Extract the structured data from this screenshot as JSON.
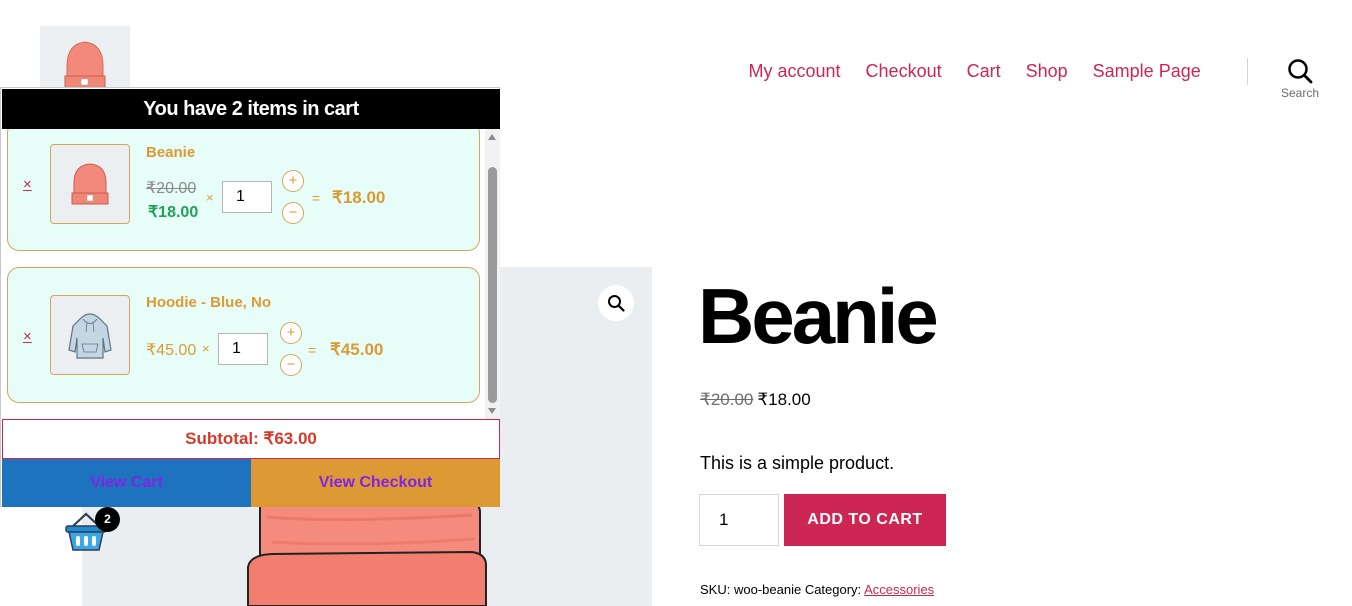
{
  "header": {
    "logo_icon": "beanie-logo",
    "nav": [
      "My account",
      "Checkout",
      "Cart",
      "Shop",
      "Sample Page"
    ],
    "search_label": "Search",
    "accent_color": "#cd2653"
  },
  "product": {
    "title": "Beanie",
    "old_price": "₹20.00",
    "price": "₹18.00",
    "description": "This is a simple product.",
    "quantity": "1",
    "add_to_cart_label": "ADD TO CART",
    "sku_label": "SKU:",
    "sku": "woo-beanie",
    "category_label": "Category:",
    "category": "Accessories",
    "zoom_icon": "magnifier-icon"
  },
  "mini_cart": {
    "header": "You have 2 items in cart",
    "items": [
      {
        "name": "Beanie",
        "original_price": "₹20.00",
        "sale_price": "₹18.00",
        "times": "×",
        "quantity": "1",
        "equals": "=",
        "line_total": "₹18.00",
        "remove": "×",
        "plus": "+",
        "minus": "−"
      },
      {
        "name": "Hoodie - Blue, No",
        "unit_price": "₹45.00",
        "times": "×",
        "quantity": "1",
        "equals": "=",
        "line_total": "₹45.00",
        "remove": "×",
        "plus": "+",
        "minus": "−"
      }
    ],
    "subtotal": "Subtotal: ₹63.00",
    "view_cart": "View Cart",
    "view_checkout": "View Checkout",
    "badge_count": "2",
    "colors": {
      "item_bg": "#e6fdf8",
      "item_border": "#d6a55a",
      "accent": "#dd9933",
      "sale": "#22a05a",
      "cart_button": "#1e73be",
      "checkout_button": "#dd9933",
      "button_text": "#8224e3"
    }
  }
}
